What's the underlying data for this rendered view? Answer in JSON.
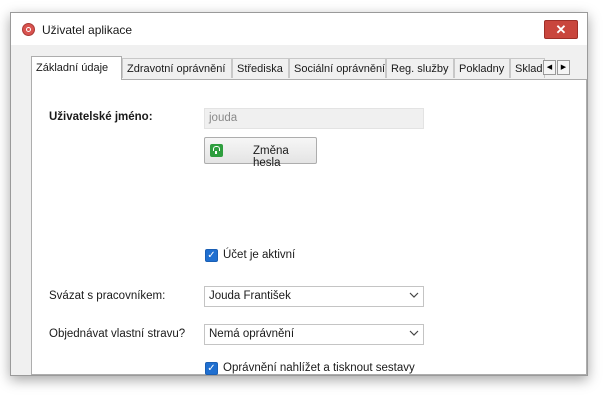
{
  "window": {
    "title": "Uživatel aplikace",
    "close_label": "✕"
  },
  "tabs": [
    {
      "label": "Základní údaje",
      "active": true
    },
    {
      "label": "Zdravotní oprávnění"
    },
    {
      "label": "Střediska"
    },
    {
      "label": "Sociální oprávnění"
    },
    {
      "label": "Reg. služby"
    },
    {
      "label": "Pokladny"
    },
    {
      "label": "Sklad"
    }
  ],
  "tab_scroll": {
    "left": "◀",
    "right": "▶"
  },
  "form": {
    "username_label": "Uživatelské jméno:",
    "username_value": "jouda",
    "change_password_label": "Změna hesla",
    "account_active_label": "Účet je aktivní",
    "account_active_checked": true,
    "link_worker_label": "Svázat s pracovníkem:",
    "link_worker_value": "Jouda František",
    "order_diet_label": "Objednávat vlastní stravu?",
    "order_diet_value": "Nemá oprávnění",
    "reports_label": "Oprávnění nahlížet a tisknout sestavy",
    "reports_checked": true
  },
  "check_mark": "✓"
}
